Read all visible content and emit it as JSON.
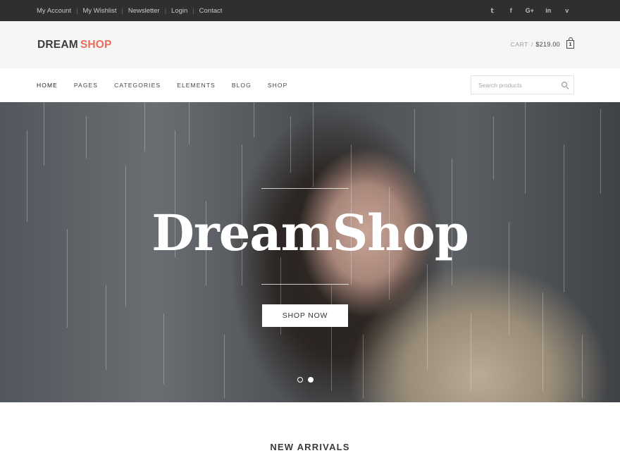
{
  "top_bar": {
    "links": [
      "My Account",
      "My Wishlist",
      "Newsletter",
      "Login",
      "Contact"
    ],
    "socials": [
      "twitter-icon",
      "facebook-icon",
      "google-plus-icon",
      "linkedin-icon",
      "vimeo-icon"
    ],
    "social_glyphs": [
      "𝕥",
      "f",
      "G+",
      "in",
      "v"
    ]
  },
  "header": {
    "logo_part1": "DREAM",
    "logo_part2": "SHOP",
    "cart_label": "CART",
    "cart_separator": "/",
    "cart_total": "$219.00",
    "cart_count": "1"
  },
  "nav": {
    "items": [
      "HOME",
      "PAGES",
      "CATEGORIES",
      "ELEMENTS",
      "BLOG",
      "SHOP"
    ],
    "search_placeholder": "Search products"
  },
  "hero": {
    "title": "DreamShop",
    "button_label": "SHOP NOW",
    "slides": 2,
    "active_slide": 2
  },
  "section": {
    "title": "NEW ARRIVALS"
  },
  "colors": {
    "topbar_bg": "#2f2f2f",
    "header_bg": "#f6f6f6",
    "accent": "#ea6f5a",
    "text_dark": "#3d3d3d"
  }
}
